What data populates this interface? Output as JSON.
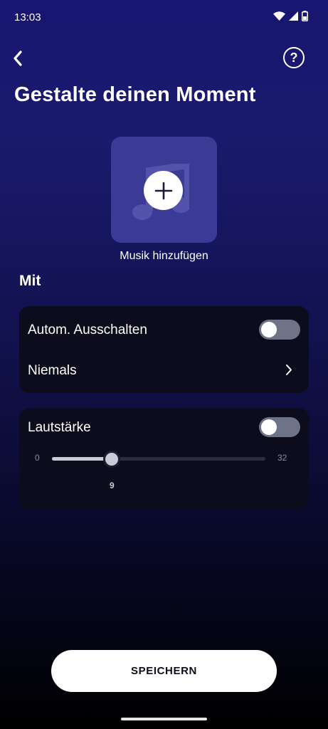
{
  "status_bar": {
    "time": "13:03",
    "icons": [
      "wifi-icon",
      "signal-icon",
      "battery-icon"
    ]
  },
  "header": {
    "back_icon": "chevron-left-icon",
    "help_label": "?",
    "title": "Gestalte deinen Moment"
  },
  "music": {
    "icon": "music-note-icon",
    "add_icon": "plus-icon",
    "label": "Musik hinzufügen"
  },
  "section": {
    "title": "Mit"
  },
  "auto_off": {
    "label": "Autom. Ausschalten",
    "enabled": false,
    "value": "Niemals",
    "chevron_icon": "chevron-right-icon"
  },
  "volume": {
    "label": "Lautstärke",
    "enabled": false,
    "min": "0",
    "max": "32",
    "value": "9"
  },
  "footer": {
    "save_label": "SPEICHERN"
  },
  "colors": {
    "background_top": "#171670",
    "background_bottom": "#000000",
    "card": "#0c0c1c",
    "tile": "#3b3b96",
    "toggle_off": "#6f7387"
  }
}
